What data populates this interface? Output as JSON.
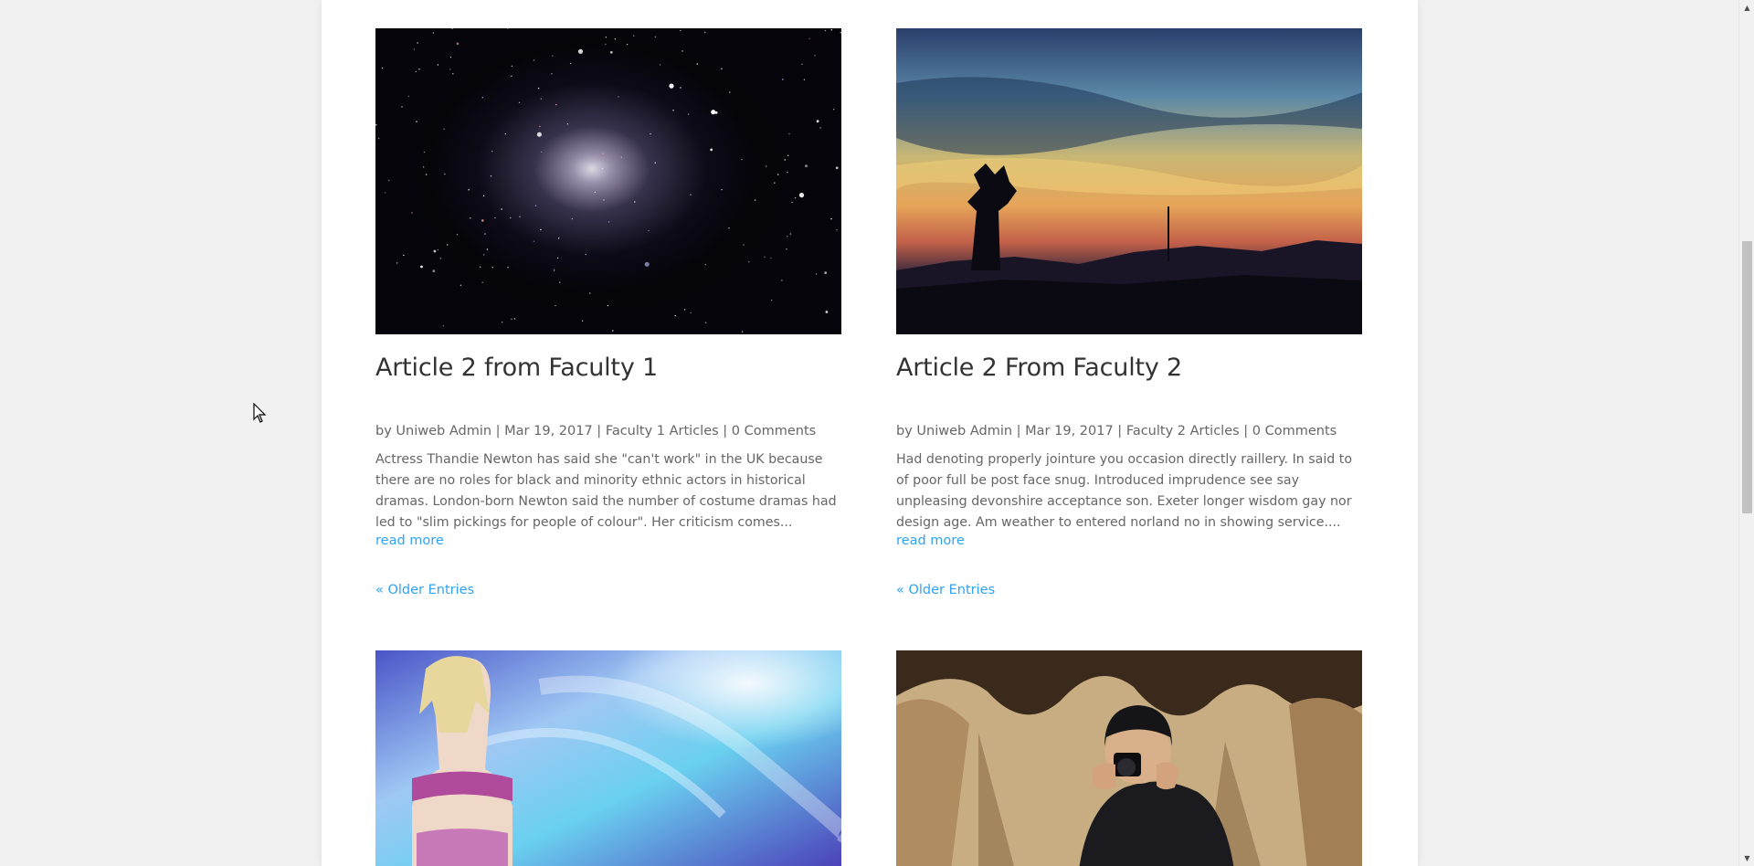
{
  "posts": [
    {
      "title": "Article 2 from Faculty 1",
      "meta": {
        "by": "by",
        "author": "Uniweb Admin",
        "sep1": " | ",
        "date": "Mar 19, 2017",
        "sep2": " | ",
        "category": "Faculty 1 Articles",
        "sep3": " | ",
        "comments": "0 Comments"
      },
      "excerpt": "Actress Thandie Newton has said she \"can't work\" in the UK because there are no roles for black and minority ethnic actors in historical dramas. London-born Newton said the number of costume dramas had led to \"slim pickings for people of colour\". Her criticism comes...",
      "read_more": "read more",
      "older_entries": "« Older Entries"
    },
    {
      "title": "Article 2 From Faculty 2",
      "meta": {
        "by": "by",
        "author": "Uniweb Admin",
        "sep1": " | ",
        "date": "Mar 19, 2017",
        "sep2": " | ",
        "category": "Faculty 2 Articles",
        "sep3": " | ",
        "comments": "0 Comments"
      },
      "excerpt": "Had denoting properly jointure you occasion directly raillery. In said to of poor full be post face snug. Introduced imprudence see say unpleasing devonshire acceptance son. Exeter longer wisdom gay nor design age. Am weather to entered norland no in showing service....",
      "read_more": "read more",
      "older_entries": "« Older Entries"
    }
  ],
  "colors": {
    "link": "#2ea3f2",
    "text": "#666666",
    "title": "#333333",
    "background": "#f1f1f1"
  }
}
